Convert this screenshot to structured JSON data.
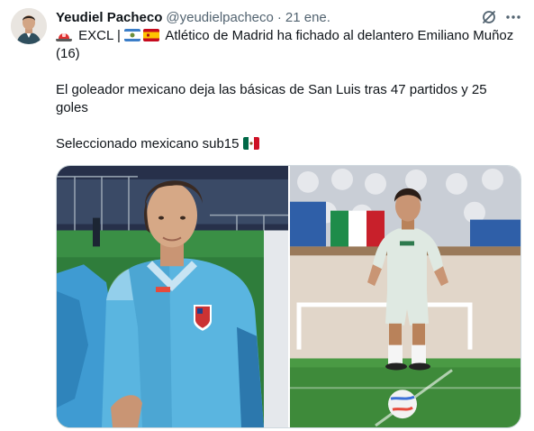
{
  "tweet": {
    "author_name": "Yeudiel Pacheco",
    "author_handle": "@yeudielpacheco",
    "separator": "·",
    "timestamp": "21 ene.",
    "line1_text": " EXCL | ",
    "line1_text_b": " Atlético de Madrid ha fichado al delantero Emiliano Muñoz",
    "line2_text": "(16)",
    "line3_text": "El goleador mexicano deja las básicas de San Luis tras 47 partidos y 25",
    "line4_text": "goles",
    "line5_text": "Seleccionado mexicano sub15 "
  },
  "icons": {
    "avatar": "profile-photo",
    "grok": "grok-icon",
    "more": "more-options-icon",
    "siren": "siren-emoji",
    "flag_slp": "san-luis-flag-emoji",
    "flag_es": "spain-flag-emoji",
    "flag_mx": "mexico-flag-emoji"
  },
  "media": {
    "photo_left_alt": "Player in Atlético de Madrid training jacket",
    "photo_right_alt": "Player in Mexico jersey with ball"
  },
  "colors": {
    "text_primary": "#0f1419",
    "text_secondary": "#536471",
    "border": "#cfd9de"
  }
}
